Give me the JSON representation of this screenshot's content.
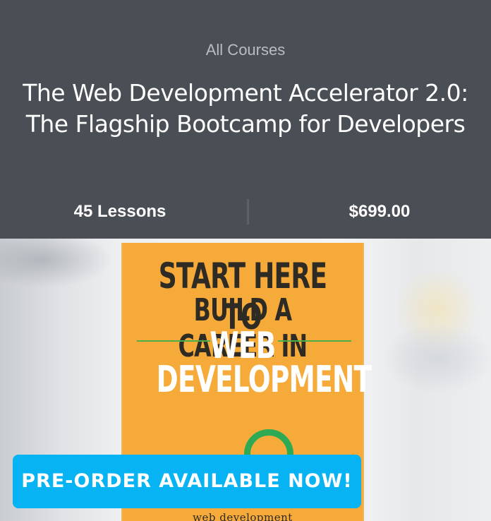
{
  "breadcrumb": "All Courses",
  "course": {
    "title_line1": "The Web Development Accelerator 2.0:",
    "title_line2": "The Flagship Bootcamp for Developers",
    "lessons": "45 Lessons",
    "price": "$699.00"
  },
  "book_cover": {
    "line1": "START HERE TO",
    "line2": "BUILD A CAREER IN",
    "line3": "WEB",
    "line4": "DEVELOPMENT",
    "subtitle": "web development",
    "bg_color": "#f5aa3a",
    "accent_color": "#2eaa55"
  },
  "cta": {
    "label": "PRE-ORDER AVAILABLE NOW!",
    "color": "#08b3f3"
  }
}
